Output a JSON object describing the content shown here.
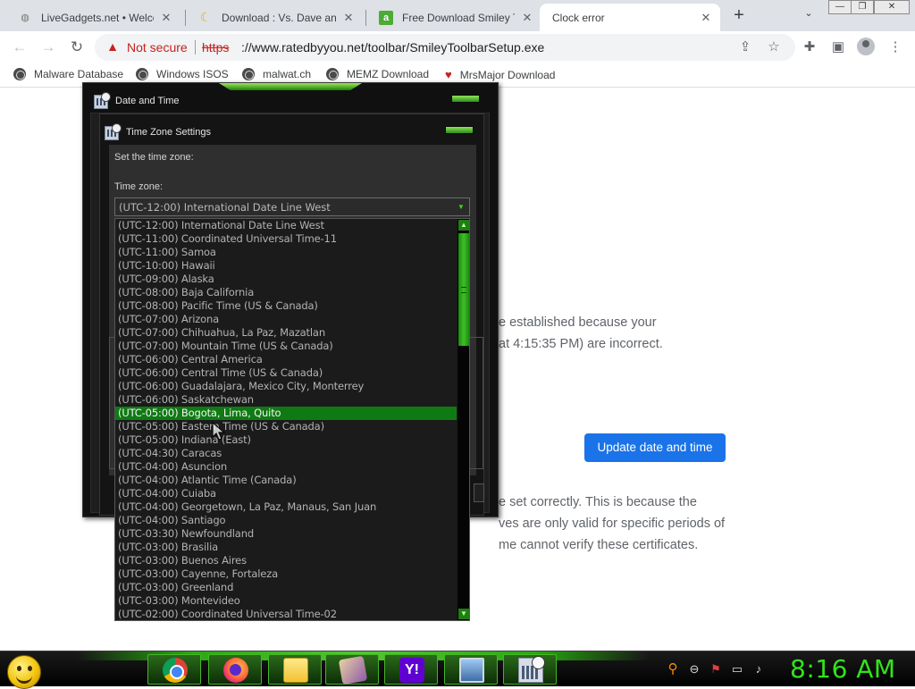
{
  "browser": {
    "tabs": [
      {
        "title": "LiveGadgets.net • Welcom",
        "icon": "globe-icon"
      },
      {
        "title": "Download : Vs. Dave and",
        "icon": "banana-icon"
      },
      {
        "title": "Free Download Smiley To",
        "icon": "softonic-icon"
      },
      {
        "title": "Clock error",
        "icon": "none",
        "active": true
      }
    ],
    "new_tab": "+",
    "tab_menu": "⌄",
    "security_label": "Not secure",
    "url_scheme": "https",
    "url_rest": "://www.ratedbyyou.net/toolbar/SmileyToolbarSetup.exe",
    "bookmarks": [
      {
        "label": "Malware Database",
        "icon": "globe-icon"
      },
      {
        "label": "Windows ISOS",
        "icon": "globe-icon"
      },
      {
        "label": "malwat.ch",
        "icon": "globe-icon"
      },
      {
        "label": "MEMZ Download",
        "icon": "globe-icon"
      },
      {
        "label": "MrsMajor Download",
        "icon": "heart-icon"
      }
    ]
  },
  "error_page": {
    "line1": "e established because your",
    "line2": "at 4:15:35 PM) are incorrect.",
    "update_button": "Update date and time",
    "para_line1": "e set correctly. This is because the",
    "para_line2": "ves are only valid for specific periods of",
    "para_line3": "me cannot verify these certificates."
  },
  "date_time_window": {
    "title": "Date and Time"
  },
  "tz_window": {
    "title": "Time Zone Settings",
    "instruction": "Set the time zone:",
    "field_label": "Time zone:",
    "selected_value": "(UTC-12:00) International Date Line West",
    "highlighted_index": 14,
    "options": [
      "(UTC-12:00) International Date Line West",
      "(UTC-11:00) Coordinated Universal Time-11",
      "(UTC-11:00) Samoa",
      "(UTC-10:00) Hawaii",
      "(UTC-09:00) Alaska",
      "(UTC-08:00) Baja California",
      "(UTC-08:00) Pacific Time (US & Canada)",
      "(UTC-07:00) Arizona",
      "(UTC-07:00) Chihuahua, La Paz, Mazatlan",
      "(UTC-07:00) Mountain Time (US & Canada)",
      "(UTC-06:00) Central America",
      "(UTC-06:00) Central Time (US & Canada)",
      "(UTC-06:00) Guadalajara, Mexico City, Monterrey",
      "(UTC-06:00) Saskatchewan",
      "(UTC-05:00) Bogota, Lima, Quito",
      "(UTC-05:00) Eastern Time (US & Canada)",
      "(UTC-05:00) Indiana (East)",
      "(UTC-04:30) Caracas",
      "(UTC-04:00) Asuncion",
      "(UTC-04:00) Atlantic Time (Canada)",
      "(UTC-04:00) Cuiaba",
      "(UTC-04:00) Georgetown, La Paz, Manaus, San Juan",
      "(UTC-04:00) Santiago",
      "(UTC-03:30) Newfoundland",
      "(UTC-03:00) Brasilia",
      "(UTC-03:00) Buenos Aires",
      "(UTC-03:00) Cayenne, Fortaleza",
      "(UTC-03:00) Greenland",
      "(UTC-03:00) Montevideo",
      "(UTC-02:00) Coordinated Universal Time-02"
    ]
  },
  "taskbar": {
    "apps": [
      "chrome-icon",
      "firefox-icon",
      "folder-icon",
      "paint-icon",
      "yahoo-icon",
      "monitor-icon",
      "calendar-icon"
    ],
    "yahoo_letter": "Y!",
    "clock": "8:16 AM"
  },
  "colors": {
    "accent_green": "#0f7a13",
    "clock_green": "#33e31c",
    "chrome_blue": "#1a73e8",
    "warning_red": "#c5221f"
  }
}
